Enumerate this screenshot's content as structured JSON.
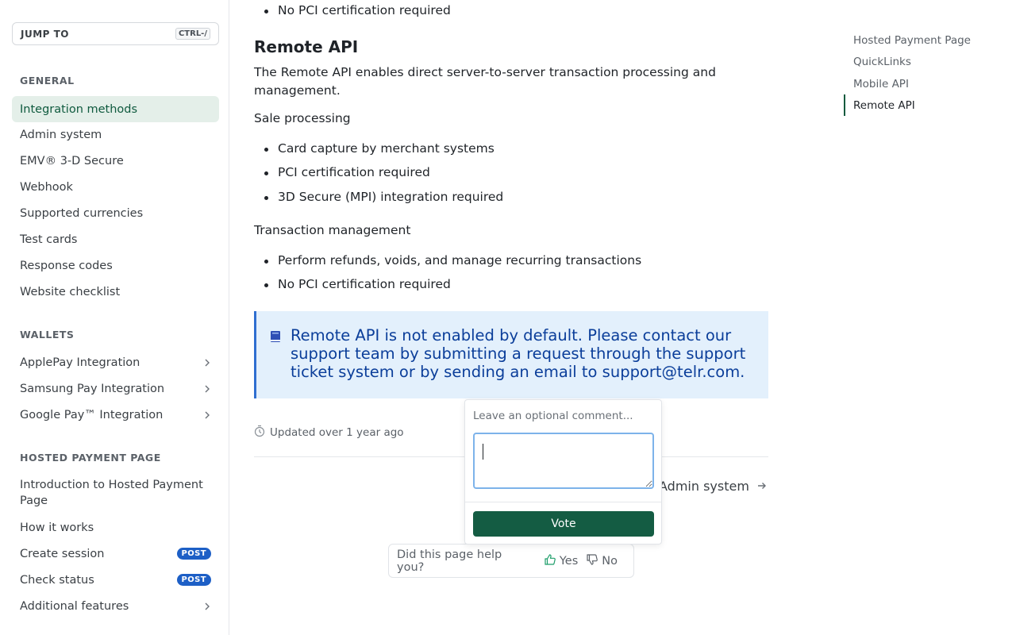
{
  "sidebar": {
    "jump_label": "JUMP TO",
    "jump_shortcut": "CTRL-/",
    "sections": [
      {
        "title": "GENERAL"
      },
      {
        "title": "WALLETS"
      },
      {
        "title": "HOSTED PAYMENT PAGE"
      }
    ],
    "general": [
      {
        "label": "Integration methods"
      },
      {
        "label": "Admin system"
      },
      {
        "label": "EMV® 3-D Secure"
      },
      {
        "label": "Webhook"
      },
      {
        "label": "Supported currencies"
      },
      {
        "label": "Test cards"
      },
      {
        "label": "Response codes"
      },
      {
        "label": "Website checklist"
      }
    ],
    "wallets": [
      {
        "label": "ApplePay Integration"
      },
      {
        "label": "Samsung Pay Integration"
      },
      {
        "label": "Google Pay™ Integration"
      }
    ],
    "hpp": [
      {
        "label": "Introduction to Hosted Payment Page"
      },
      {
        "label": "How it works"
      },
      {
        "label": "Create session",
        "badge": "POST"
      },
      {
        "label": "Check status",
        "badge": "POST"
      },
      {
        "label": "Additional features"
      }
    ]
  },
  "content": {
    "top_bullet": "No PCI certification required",
    "heading": "Remote API",
    "intro": "The Remote API enables direct server-to-server transaction processing and management.",
    "sale_title": "Sale processing",
    "sale_items": [
      "Card capture by merchant systems",
      "PCI certification required",
      "3D Secure (MPI) integration required"
    ],
    "txn_title": "Transaction management",
    "txn_items": [
      "Perform refunds, voids, and manage recurring transactions",
      "No PCI certification required"
    ],
    "callout": "Remote API is not enabled by default. Please contact our support team by submitting a request through the support ticket system or by sending an email to support@telr.com.",
    "updated": "Updated over 1 year ago",
    "next_link": "Admin system"
  },
  "feedback": {
    "question": "Did this page help you?",
    "yes": "Yes",
    "no": "No",
    "comment_label": "Leave an optional comment...",
    "comment_value": "",
    "vote_label": "Vote"
  },
  "toc": {
    "items": [
      {
        "label": "Hosted Payment Page"
      },
      {
        "label": "QuickLinks"
      },
      {
        "label": "Mobile API"
      },
      {
        "label": "Remote API"
      }
    ]
  },
  "colors": {
    "accent_green": "#145c43",
    "active_nav_bg": "#e4efe9",
    "callout_bg": "#e3f0fc",
    "callout_text": "#0b3e9a",
    "badge_blue": "#1d5fc6"
  }
}
